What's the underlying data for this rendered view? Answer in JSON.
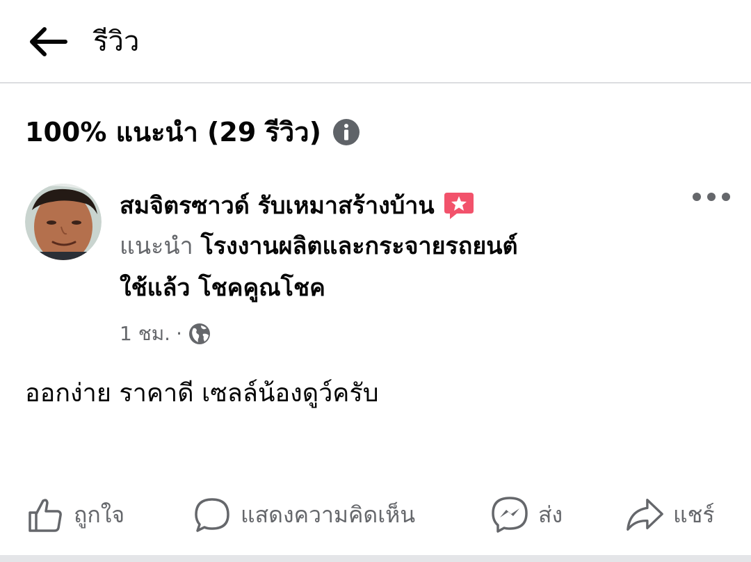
{
  "header": {
    "title": "รีวิว"
  },
  "summary": {
    "text": "100% แนะนำ (29 รีวิว)"
  },
  "post": {
    "author": "สมจิตรซาวด์ รับเหมาสร้างบ้าน",
    "recommend_word": "แนะนำ",
    "page_name_line1": "โรงงานผลิตและกระจายรถยนต์",
    "page_name_line2": "ใช้แล้ว โชคคูณโชค",
    "time": "1 ชม.",
    "separator": "·",
    "privacy_icon": "globe-icon",
    "badge_icon": "star-speech-bubble-icon",
    "review_text": "ออกง่าย ราคาดี เซลล์น้องดูว์ครับ"
  },
  "actions": {
    "like": "ถูกใจ",
    "comment": "แสดงความคิดเห็น",
    "send": "ส่ง",
    "share": "แชร์"
  },
  "colors": {
    "accent_badge": "#f2526b",
    "secondary_text": "#65676b",
    "primary_text": "#050505"
  }
}
